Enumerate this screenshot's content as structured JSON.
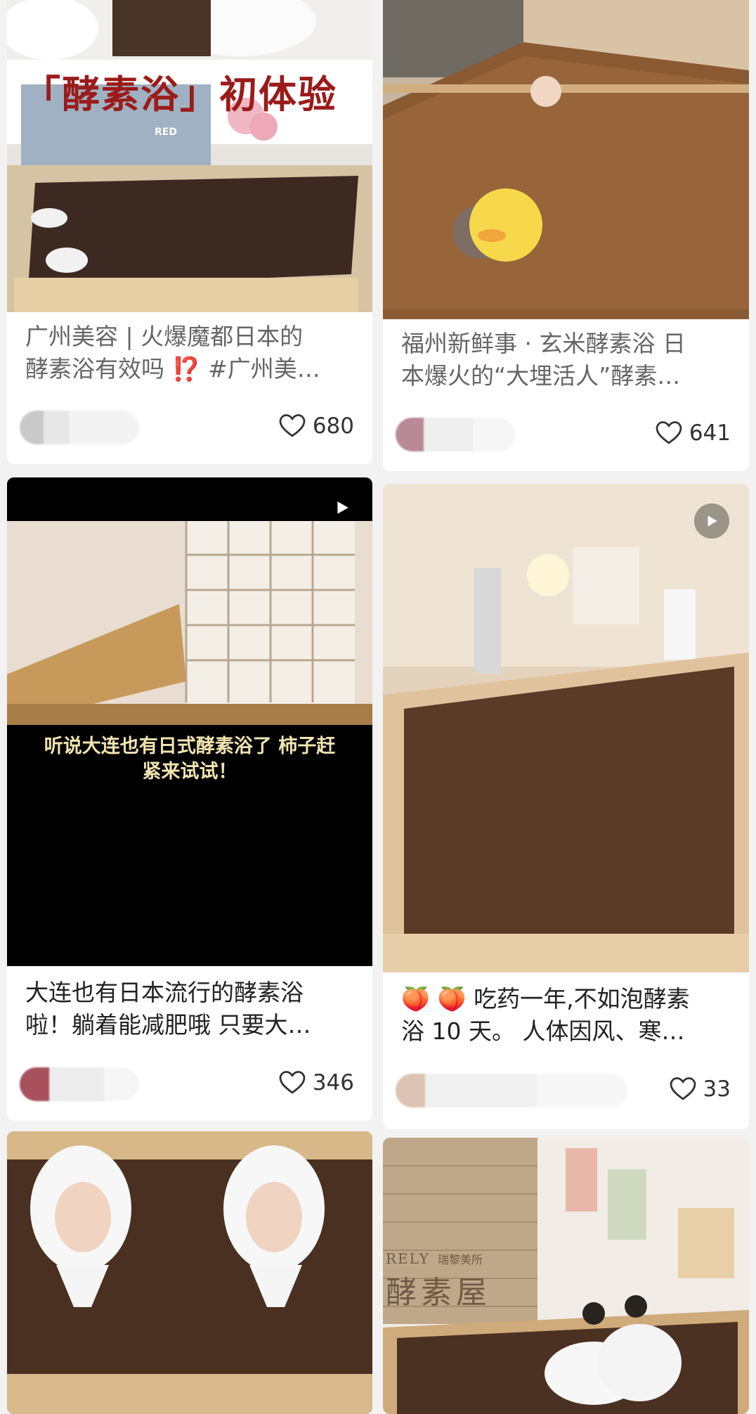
{
  "cards": [
    {
      "title_line1": "广州美容 | 火爆魔都日本的",
      "title_line2": "酵素浴有效吗 ⁉️ #广州美…",
      "likes": "680",
      "overlay": "「酵素浴」初体验",
      "watermark": "RED"
    },
    {
      "title_line1": "福州新鲜事 · 玄米酵素浴 日",
      "title_line2": "本爆火的“大埋活人”酵素…",
      "likes": "641"
    },
    {
      "title_line1": "大连也有日本流行的酵素浴",
      "title_line2": "啦！躺着能减肥哦 只要大…",
      "likes": "346",
      "subtitle_line1": "听说大连也有日式酵素浴了 柿子赶",
      "subtitle_line2": "紧来试试！"
    },
    {
      "title_line1": "🍑 🍑 吃药一年,不如泡酵素",
      "title_line2": "浴 10 天。 人体因风、寒…",
      "likes": "33"
    },
    {},
    {
      "sign_en": "RELY",
      "sign_cn": "瑞黎美所",
      "sign_main": "酵素屋"
    }
  ],
  "icons": {
    "like": "heart-icon",
    "play": "play-icon"
  },
  "colors": {
    "background": "#f2f2f2",
    "card": "#ffffff",
    "text": "#222222",
    "overlay_red": "#9b1b1b"
  }
}
